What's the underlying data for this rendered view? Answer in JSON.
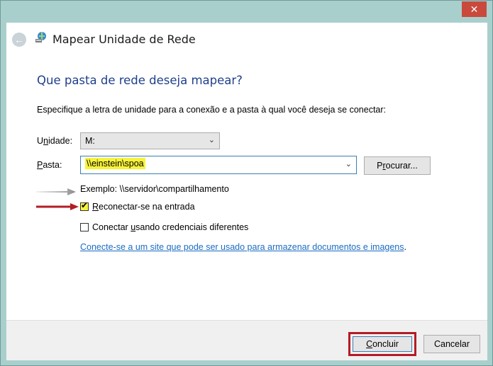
{
  "window": {
    "close_glyph": "✕"
  },
  "titlebar": {
    "title": "Mapear Unidade de Rede",
    "back_icon": "back-arrow-icon",
    "app_icon": "network-drive-icon"
  },
  "main": {
    "heading": "Que pasta de rede deseja mapear?",
    "instruction": "Especifique a letra de unidade para a conexão e a pasta à qual você deseja se conectar:",
    "drive": {
      "label_pre": "U",
      "label_u": "n",
      "label_post": "idade:",
      "value": "M:"
    },
    "folder": {
      "label_pre": "",
      "label_u": "P",
      "label_post": "asta:",
      "value": "\\\\einstein\\spoa"
    },
    "browse": {
      "pre": "P",
      "u": "r",
      "post": "ocurar..."
    },
    "example": "Exemplo: \\\\servidor\\compartilhamento",
    "reconnect": {
      "pre": "",
      "u": "R",
      "post": "econectar-se na entrada",
      "checked": true
    },
    "credentials": {
      "pre": "Conectar ",
      "u": "u",
      "post": "sando credenciais diferentes",
      "checked": false
    },
    "link": "Conecte-se a um site que pode ser usado para armazenar documentos e imagens",
    "link_suffix": "."
  },
  "footer": {
    "finish": {
      "pre": "",
      "u": "C",
      "post": "oncluir"
    },
    "cancel": "Cancelar"
  },
  "colors": {
    "heading": "#1f3f8b",
    "link": "#1a6cc2",
    "highlight": "#f7f33a",
    "annotation_red": "#b31c25",
    "window_frame": "#a9cfcd"
  }
}
